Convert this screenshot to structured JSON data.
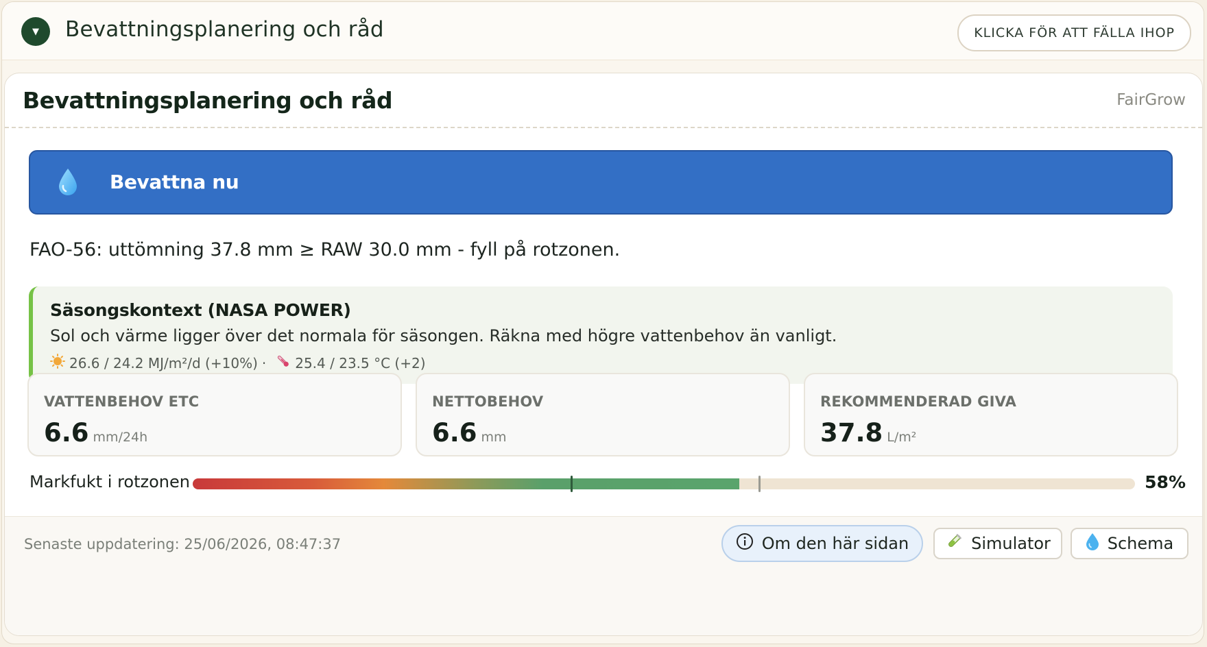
{
  "header": {
    "title": "Bevattningsplanering och råd",
    "collapse_label": "KLICKA FÖR ATT FÄLLA IHOP",
    "toggle_glyph": "▼"
  },
  "card": {
    "title": "Bevattningsplanering och råd",
    "brand": "FairGrow"
  },
  "banner": {
    "text": "Bevattna nu",
    "icon": "water-drop-icon",
    "color": "#336fc5"
  },
  "fao_text": "FAO-56: uttömning 37.8 mm ≥ RAW 30.0 mm - fyll på rotzonen.",
  "season": {
    "title": "Säsongskontext (NASA POWER)",
    "description": "Sol och värme ligger över det normala för säsongen. Räkna med högre vattenbehov än vanligt.",
    "radiation": "26.6 / 24.2 MJ/m²/d (+10%)",
    "separator": "·",
    "temperature": "25.4 / 23.5 °C (+2)",
    "accent": "#76c246"
  },
  "metrics": [
    {
      "label": "VATTENBEHOV ETC",
      "value": "6.6",
      "unit": "mm/24h"
    },
    {
      "label": "NETTOBEHOV",
      "value": "6.6",
      "unit": "mm"
    },
    {
      "label": "REKOMMENDERAD GIVA",
      "value": "37.8",
      "unit": "L/m²"
    }
  ],
  "moisture": {
    "label": "Markfukt i rotzonen",
    "percent_text": "58%",
    "level": 0.58,
    "marker_low": 0.402,
    "marker_high": 0.601
  },
  "footer": {
    "updated": "Senaste uppdatering: 25/06/2026, 08:47:37",
    "about_label": "Om den här sidan",
    "simulator_label": "Simulator",
    "schedule_label": "Schema"
  }
}
